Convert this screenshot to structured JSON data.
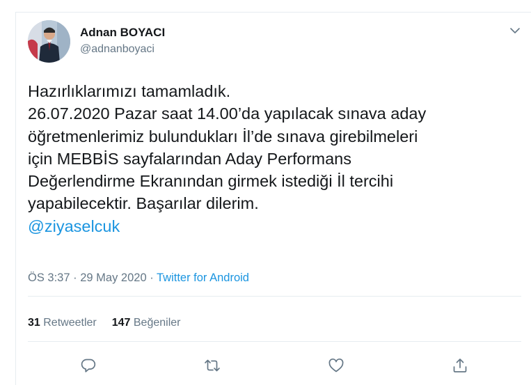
{
  "author": {
    "name": "Adnan BOYACI",
    "handle": "@adnanboyaci"
  },
  "tweet": {
    "lines": [
      "Hazırlıklarımızı tamamladık.",
      "26.07.2020 Pazar saat 14.00’da yapılacak sınava aday",
      "öğretmenlerimiz bulundukları İl’de sınava girebilmeleri",
      "için MEBBİS sayfalarından Aday Performans",
      "Değerlendirme Ekranından girmek istediği İl tercihi",
      "yapabilecektir. Başarılar dilerim."
    ],
    "mention": "@ziyaselcuk"
  },
  "meta": {
    "time": "ÖS 3:37",
    "separator": " · ",
    "date": "29 May 2020",
    "source": "Twitter for Android"
  },
  "stats": {
    "retweets_count": "31",
    "retweets_label": " Retweetler",
    "likes_count": "147",
    "likes_label": " Beğeniler"
  },
  "icons": {
    "menu": "chevron-down-icon",
    "reply": "reply-icon",
    "retweet": "retweet-icon",
    "like": "heart-icon",
    "share": "share-icon"
  },
  "colors": {
    "text": "#14171a",
    "secondary": "#657786",
    "link": "#1b95e0",
    "divider": "#e6ecf0"
  }
}
